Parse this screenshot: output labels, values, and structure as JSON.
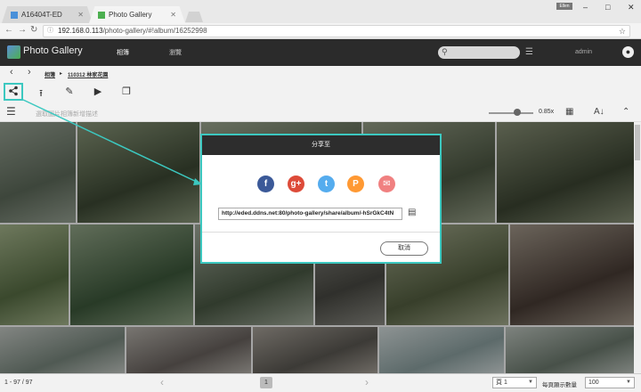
{
  "browser": {
    "tabs": [
      {
        "label": "A16404T-ED",
        "favicon_color": "#4a90d9"
      },
      {
        "label": "Photo Gallery",
        "favicon_color": "#4caf50"
      }
    ],
    "user_chip": "Ellen",
    "url_host": "192.168.0.113",
    "url_path": "/photo-gallery/#!album/16252998",
    "window_controls": [
      "–",
      "□",
      "✕"
    ]
  },
  "app": {
    "title": "Photo Gallery",
    "nav_tabs": [
      "相簿",
      "瀏覽"
    ],
    "user": "admin"
  },
  "breadcrumb": {
    "root": "相簿",
    "current": "110312 林家花園"
  },
  "filter": {
    "hint": "選取圖片相簿新增描述",
    "zoom": "0.85x"
  },
  "footer": {
    "count": "1 - 97 / 97",
    "page": "1",
    "page_select": "頁 1",
    "per_page_label": "每頁顯示數量",
    "per_page_value": "100"
  },
  "dialog": {
    "title": "分享至",
    "social": [
      {
        "name": "facebook-icon",
        "glyph": "f",
        "color": "#3b5998"
      },
      {
        "name": "google-plus-icon",
        "glyph": "g+",
        "color": "#dd4b39"
      },
      {
        "name": "twitter-icon",
        "glyph": "t",
        "color": "#55acee"
      },
      {
        "name": "plurk-icon",
        "glyph": "P",
        "color": "#ff9933"
      },
      {
        "name": "email-icon",
        "glyph": "✉",
        "color": "#f08080"
      }
    ],
    "share_url": "http://eded.ddns.net:80/photo-gallery/share/album/-hSrGkC4tN",
    "cancel_label": "取消"
  },
  "colors": {
    "accent": "#3cc8c0",
    "header_bg": "#2b2b2b"
  }
}
